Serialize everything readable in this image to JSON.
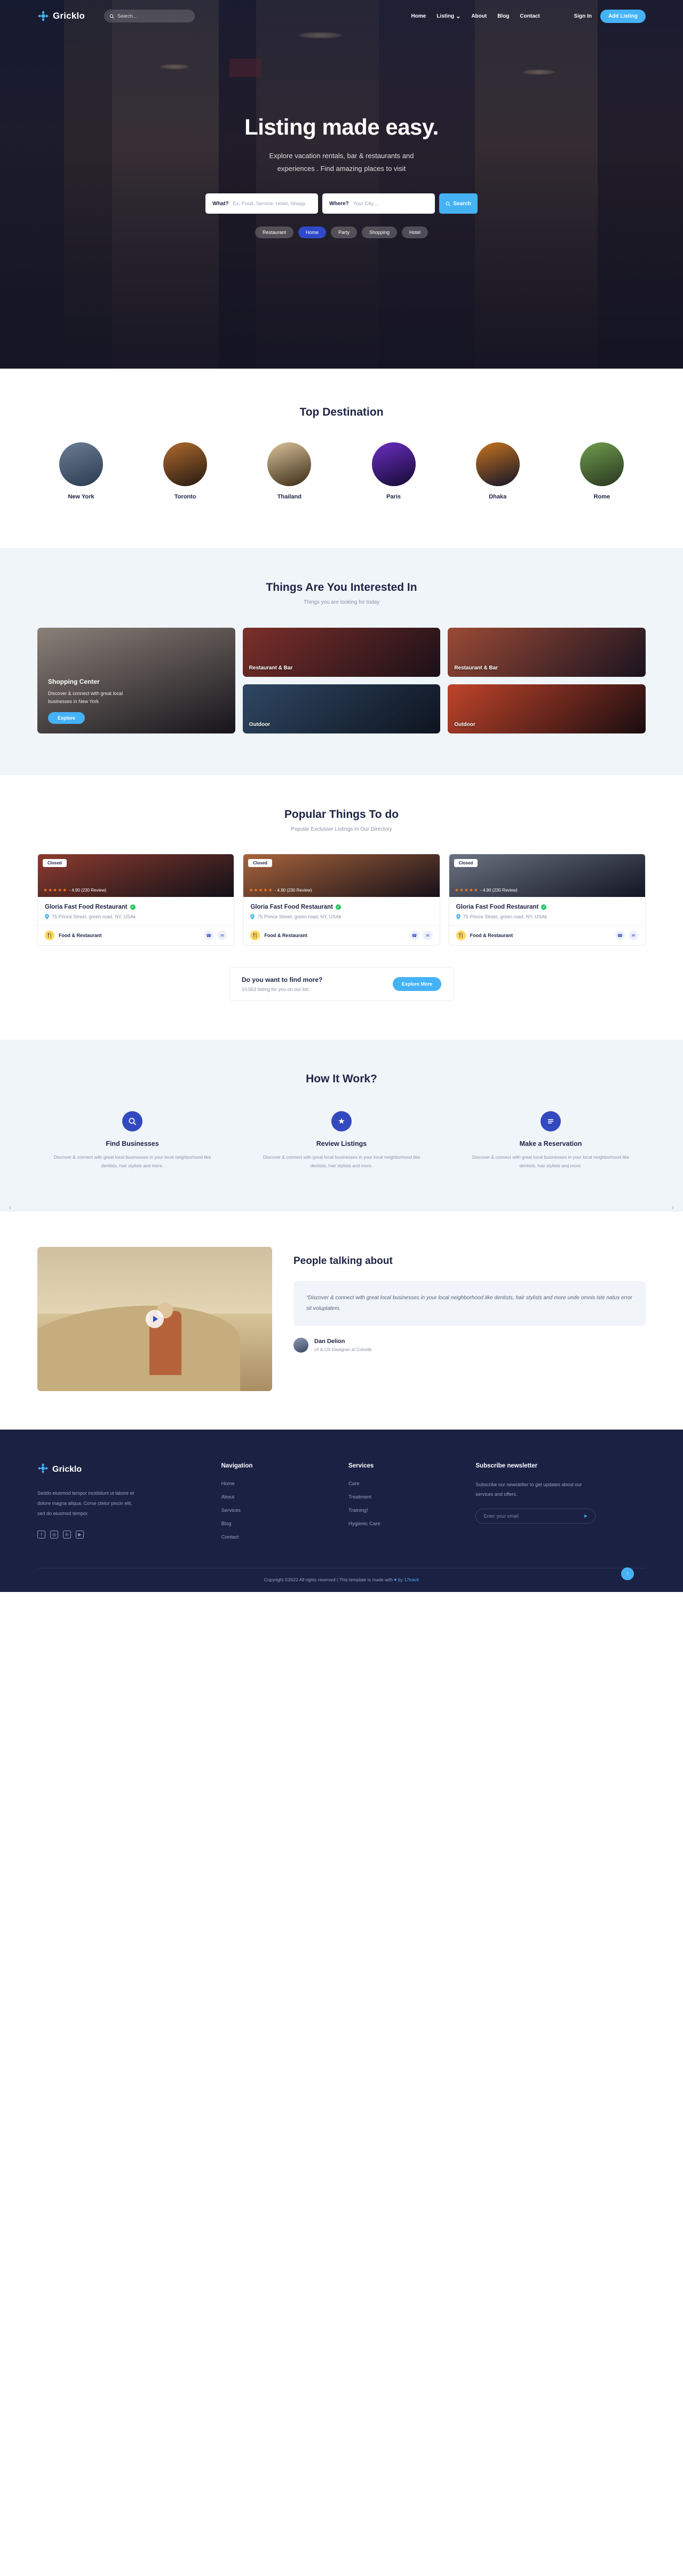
{
  "brand": {
    "name": "Gricklo",
    "accent": "#45b2f6",
    "deep": "#2f49c9",
    "dark": "#1b2143"
  },
  "navbar": {
    "search_placeholder": "Search...",
    "links": [
      {
        "label": "Home"
      },
      {
        "label": "Listing",
        "caret": "⌄"
      },
      {
        "label": "About"
      },
      {
        "label": "Blog"
      },
      {
        "label": "Contact"
      }
    ],
    "signin": "Sign In",
    "cta": "Add Listing"
  },
  "hero": {
    "title": "Listing made easy.",
    "subtitle_line1": "Explore vacation rentals, bar & restaurants and",
    "subtitle_line2": "experiences . Find amazing places to visit",
    "what_label": "What?",
    "what_placeholder": "Ex: Food, Service, Hotel, Shopp",
    "where_label": "Where?",
    "where_placeholder": "Your City....",
    "search_button": "Search",
    "pills": [
      {
        "label": "Restaurant",
        "active": false
      },
      {
        "label": "Home",
        "active": true
      },
      {
        "label": "Party",
        "active": false
      },
      {
        "label": "Shopping",
        "active": false
      },
      {
        "label": "Hotel",
        "active": false
      }
    ]
  },
  "destinations": {
    "title": "Top Destination",
    "items": [
      {
        "name": "New York",
        "c1": "#6d7d92",
        "c2": "#2a3a52"
      },
      {
        "name": "Toronto",
        "c1": "#b06a2e",
        "c2": "#241a12"
      },
      {
        "name": "Thailand",
        "c1": "#d9c39a",
        "c2": "#3a2a16"
      },
      {
        "name": "Paris",
        "c1": "#6b2ec4",
        "c2": "#140a30"
      },
      {
        "name": "Dhaka",
        "c1": "#c9741f",
        "c2": "#101428"
      },
      {
        "name": "Rome",
        "c1": "#6f9e4e",
        "c2": "#2a3520"
      }
    ]
  },
  "interested": {
    "title": "Things Are You Interested In",
    "subtitle": "Things you are looking for today",
    "cards": [
      {
        "caption": "Restaurant & Bar",
        "c1": "#7c2f2a",
        "c2": "#1b1018"
      },
      {
        "caption": "Restaurant & Bar",
        "c1": "#9b4a35",
        "c2": "#1a1320"
      },
      {
        "caption": "Outdoor",
        "c1": "#2f4763",
        "c2": "#0e141f"
      },
      {
        "caption": "Outdoor",
        "c1": "#c0442a",
        "c2": "#1a0c10"
      }
    ],
    "feature": {
      "title": "Shopping Center",
      "text": "Discover & connect with great local businesses in New York",
      "button": "Explore",
      "c1": "#6d6a66",
      "c2": "#16141a"
    }
  },
  "popular": {
    "title": "Popular Things To do",
    "subtitle": "Popular Exclusive Listings In Our Directory",
    "prev": "‹",
    "next": "›",
    "listings": [
      {
        "status": "Closed",
        "stars": "★★★★★",
        "rating_text": "- 4.90 (230 Review)",
        "name": "Gloria Fast Food Restaurant",
        "verified": "✓",
        "address": "75 Prince Street, green road, NY, USAk",
        "category": "Food & Restaurant",
        "category_icon": "ᵞ",
        "phone_icon": "☎",
        "mail_icon": "✉",
        "c1": "#8c3b2e",
        "c2": "#121018"
      },
      {
        "status": "Closed",
        "stars": "★★★★★",
        "rating_text": "- 4.90 (230 Review)",
        "name": "Gloria Fast Food Restaurant",
        "verified": "✓",
        "address": "75 Prince Street, green road, NY, USAk",
        "category": "Food & Restaurant",
        "category_icon": "ᵞ",
        "phone_icon": "☎",
        "mail_icon": "✉",
        "c1": "#a7643b",
        "c2": "#171019"
      },
      {
        "status": "Closed",
        "stars": "★★★★★",
        "rating_text": "- 4.90 (230 Review)",
        "name": "Gloria Fast Food Restaurant",
        "verified": "✓",
        "address": "75 Prince Street, green road, NY, USAk",
        "category": "Food & Restaurant",
        "category_icon": "ᵞ",
        "phone_icon": "☎",
        "mail_icon": "✉",
        "c1": "#6b7280",
        "c2": "#121624"
      }
    ],
    "findmore": {
      "title": "Do you want to find more?",
      "subtitle": "10,563 listing for you on our list.",
      "button": "Explore More"
    }
  },
  "howitwork": {
    "title": "How It Work?",
    "steps": [
      {
        "icon": "⌕",
        "title": "Find Businesses",
        "text": "Discover & connect with great local businesses in your local neighborhood like dentists, hair stylists and more."
      },
      {
        "icon": "★",
        "title": "Review Listings",
        "text": "Discover & connect with great local businesses in your local neighborhood like dentists, hair stylists and more."
      },
      {
        "icon": "☰",
        "title": "Make a Reservation",
        "text": "Discover & connect with great local businesses in your local neighborhood like dentists, hair stylists and more."
      }
    ]
  },
  "testimonial": {
    "heading": "People talking about",
    "quote": "“Discover & connect with great local businesses in your local neighborhood like dentists, hair stylists and more unde omnis iste natus error sit voluptatem.",
    "person_name": "Dan Delion",
    "person_role": "UI & UX Designer at Colorlib",
    "play_icon": "play-triangle"
  },
  "footer": {
    "brand": "Gricklo",
    "desc": "Seddo eiusmod tempor incididunt ut labore et dolore magna aliqua. Corse ctetur piscin elit, sed do eiusmod tempor.",
    "socials": [
      "f",
      "◎",
      "in",
      "▶"
    ],
    "columns": [
      {
        "heading": "Navigation",
        "links": [
          "Home",
          "About",
          "Services",
          "Blog",
          "Contact"
        ]
      },
      {
        "heading": "Services",
        "links": [
          "Care",
          "Treatment",
          "Training!",
          "Hygienic Care"
        ]
      }
    ],
    "newsletter": {
      "heading": "Subscribe newsletter",
      "text": "Subscribe our newsletter to get updates about our services and offers.",
      "placeholder": "Enter your email",
      "send_icon": "➤"
    },
    "copyright_pre": "Copyright ©2022 All rights reserved | This template is made with ",
    "copyright_heart": "♥",
    "copyright_mid": " by ",
    "copyright_brand": "17track",
    "fab_icon": "↑"
  }
}
